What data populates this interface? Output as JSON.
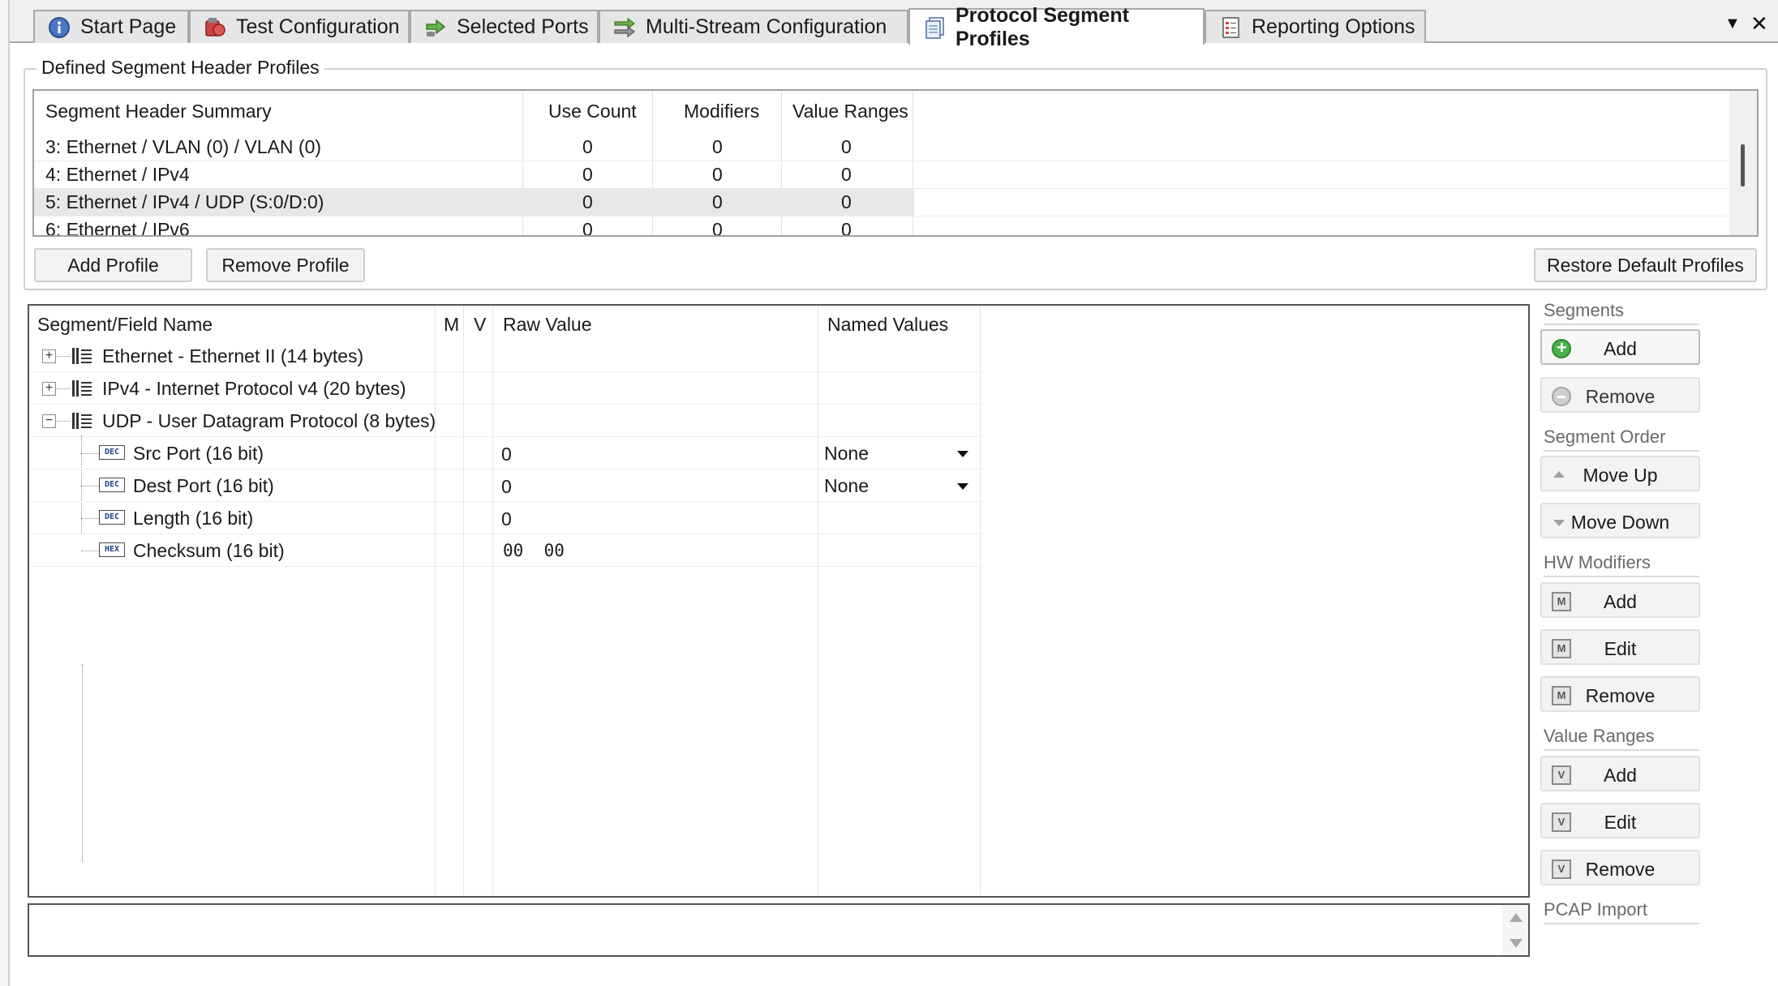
{
  "tabs": [
    {
      "label": "Start Page",
      "icon": "info-icon"
    },
    {
      "label": "Test Configuration",
      "icon": "test-config-icon"
    },
    {
      "label": "Selected Ports",
      "icon": "ports-icon"
    },
    {
      "label": "Multi-Stream Configuration",
      "icon": "multistream-icon"
    },
    {
      "label": "Protocol Segment Profiles",
      "icon": "profiles-icon",
      "active": true
    },
    {
      "label": "Reporting Options",
      "icon": "report-icon"
    }
  ],
  "tab_controls": {
    "dropdown": "▼",
    "close": "✕"
  },
  "profiles_group": {
    "title": "Defined Segment Header Profiles",
    "columns": [
      "Segment Header Summary",
      "Use Count",
      "Modifiers",
      "Value Ranges"
    ],
    "rows": [
      {
        "summary": "3: Ethernet / VLAN (0) / VLAN (0)",
        "use_count": "0",
        "modifiers": "0",
        "value_ranges": "0"
      },
      {
        "summary": "4: Ethernet / IPv4",
        "use_count": "0",
        "modifiers": "0",
        "value_ranges": "0"
      },
      {
        "summary": "5: Ethernet / IPv4 / UDP (S:0/D:0)",
        "use_count": "0",
        "modifiers": "0",
        "value_ranges": "0",
        "selected": true
      },
      {
        "summary": "6: Ethernet / IPv6",
        "use_count": "0",
        "modifiers": "0",
        "value_ranges": "0"
      }
    ],
    "add_profile": "Add Profile",
    "remove_profile": "Remove Profile",
    "restore_defaults": "Restore Default Profiles"
  },
  "segment_tree": {
    "columns": [
      "Segment/Field Name",
      "M",
      "V",
      "Raw Value",
      "Named Values"
    ],
    "segments": [
      {
        "name": "Ethernet - Ethernet II (14 bytes)",
        "expander": "+"
      },
      {
        "name": "IPv4 - Internet Protocol v4 (20 bytes)",
        "expander": "+"
      },
      {
        "name": "UDP - User Datagram Protocol (8 bytes)",
        "expander": "−"
      }
    ],
    "fields": [
      {
        "type": "DEC",
        "name": "Src Port (16 bit)",
        "raw": "0",
        "named": "None"
      },
      {
        "type": "DEC",
        "name": "Dest Port (16 bit)",
        "raw": "0",
        "named": "None"
      },
      {
        "type": "DEC",
        "name": "Length (16 bit)",
        "raw": "0",
        "named": ""
      },
      {
        "type": "HEX",
        "name": "Checksum (16 bit)",
        "raw": "00  00",
        "named": ""
      }
    ]
  },
  "right_panel": {
    "segments": {
      "title": "Segments",
      "add": "Add",
      "remove": "Remove"
    },
    "segment_order": {
      "title": "Segment Order",
      "move_up": "Move Up",
      "move_down": "Move Down"
    },
    "hw_modifiers": {
      "title": "HW Modifiers",
      "add": "Add",
      "edit": "Edit",
      "remove": "Remove",
      "icon_letter": "M"
    },
    "value_ranges": {
      "title": "Value Ranges",
      "add": "Add",
      "edit": "Edit",
      "remove": "Remove",
      "icon_letter": "V"
    },
    "pcap_import": {
      "title": "PCAP Import"
    }
  }
}
